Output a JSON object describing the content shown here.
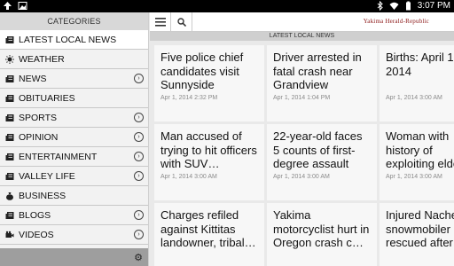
{
  "statusbar": {
    "time": "3:07 PM"
  },
  "sidebar": {
    "header": "CATEGORIES",
    "items": [
      {
        "label": "LATEST LOCAL NEWS",
        "icon": "news-icon",
        "chevron": false,
        "active": true
      },
      {
        "label": "WEATHER",
        "icon": "sun-icon",
        "chevron": false,
        "active": false
      },
      {
        "label": "NEWS",
        "icon": "news-icon",
        "chevron": true,
        "active": false
      },
      {
        "label": "OBITUARIES",
        "icon": "news-icon",
        "chevron": false,
        "active": false
      },
      {
        "label": "SPORTS",
        "icon": "news-icon",
        "chevron": true,
        "active": false
      },
      {
        "label": "OPINION",
        "icon": "news-icon",
        "chevron": true,
        "active": false
      },
      {
        "label": "ENTERTAINMENT",
        "icon": "news-icon",
        "chevron": true,
        "active": false
      },
      {
        "label": "VALLEY LIFE",
        "icon": "news-icon",
        "chevron": true,
        "active": false
      },
      {
        "label": "BUSINESS",
        "icon": "money-bag-icon",
        "chevron": false,
        "active": false
      },
      {
        "label": "BLOGS",
        "icon": "news-icon",
        "chevron": true,
        "active": false
      },
      {
        "label": "VIDEOS",
        "icon": "video-camera-icon",
        "chevron": true,
        "active": false
      }
    ]
  },
  "topbar": {
    "logo": "Yakima Herald-Republic"
  },
  "section_title": "LATEST LOCAL NEWS",
  "articles": [
    {
      "headline": "Five police chief candidates visit Sunnyside",
      "date": "Apr 1, 2014 2:32 PM"
    },
    {
      "headline": "Driver arrested in fatal crash near Grandview",
      "date": "Apr 1, 2014 1:04 PM"
    },
    {
      "headline": "Births: April 1, 2014",
      "date": "Apr 1, 2014 3:00 AM"
    },
    {
      "headline": "Man accused of trying to hit officers with SUV…",
      "date": "Apr 1, 2014 3:00 AM"
    },
    {
      "headline": "22-year-old faces 5 counts of first-degree assault in…",
      "date": "Apr 1, 2014 3:00 AM"
    },
    {
      "headline": "Woman with history of exploiting elderly…",
      "date": "Apr 1, 2014 3:00 AM"
    },
    {
      "headline": "Charges refiled against Kittitas landowner, tribal…",
      "date": ""
    },
    {
      "headline": "Yakima motorcyclist hurt in Oregon crash c…",
      "date": ""
    },
    {
      "headline": "Injured Naches snowmobiler rescued after…",
      "date": ""
    }
  ]
}
